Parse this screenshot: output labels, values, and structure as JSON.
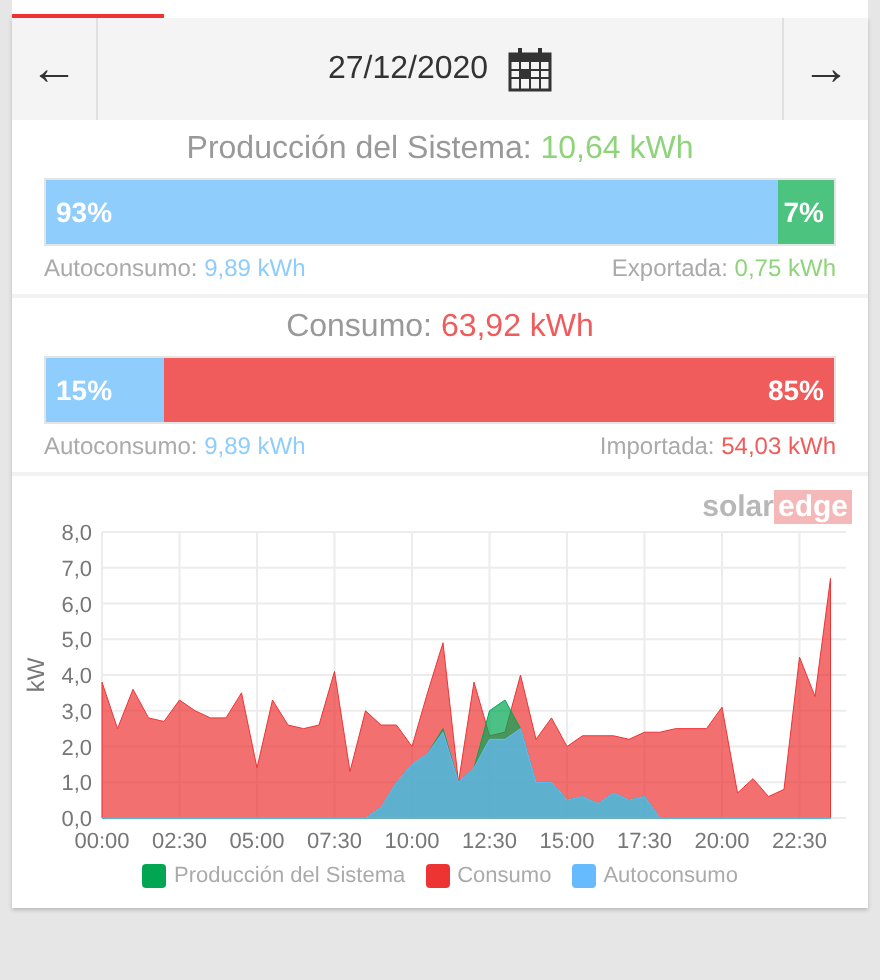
{
  "nav": {
    "prev": "←",
    "date": "27/12/2020",
    "next": "→"
  },
  "production": {
    "label": "Producción del Sistema:",
    "value": "10,64 kWh",
    "bar": [
      {
        "kind": "self",
        "level": 0.93,
        "text": "93%"
      },
      {
        "kind": "export",
        "level": 0.07,
        "text": "7%"
      }
    ],
    "left": {
      "label": "Autoconsumo:",
      "value": "9,89 kWh",
      "kind": "self"
    },
    "right": {
      "label": "Exportada:",
      "value": "0,75 kWh",
      "kind": "export"
    }
  },
  "consumption": {
    "label": "Consumo:",
    "value": "63,92 kWh",
    "bar": [
      {
        "kind": "self",
        "level": 0.15,
        "text": "15%"
      },
      {
        "kind": "import",
        "level": 0.85,
        "text": "85%"
      }
    ],
    "left": {
      "label": "Autoconsumo:",
      "value": "9,89 kWh",
      "kind": "self"
    },
    "right": {
      "label": "Importada:",
      "value": "54,03 kWh",
      "kind": "import"
    }
  },
  "logo": {
    "part1": "solar",
    "part2": "edge"
  },
  "chart": {
    "chart_data": {
      "type": "area",
      "ylabel": "kW",
      "x": [
        0,
        0.5,
        1,
        1.5,
        2,
        2.5,
        3,
        3.5,
        4,
        4.5,
        5,
        5.5,
        6,
        6.5,
        7,
        7.5,
        8,
        8.5,
        9,
        9.5,
        10,
        10.5,
        11,
        11.5,
        12,
        12.5,
        13,
        13.5,
        14,
        14.5,
        15,
        15.5,
        16,
        16.5,
        17,
        17.5,
        18,
        18.5,
        19,
        19.5,
        20,
        20.5,
        21,
        21.5,
        22,
        22.5,
        23,
        23.5
      ],
      "xlim": [
        0,
        24
      ],
      "ylim": [
        0,
        8
      ],
      "grid": true,
      "yticks": [
        {
          "value": 0,
          "label": "0,0"
        },
        {
          "value": 1,
          "label": "1,0"
        },
        {
          "value": 2,
          "label": "2,0"
        },
        {
          "value": 3,
          "label": "3,0"
        },
        {
          "value": 4,
          "label": "4,0"
        },
        {
          "value": 5,
          "label": "5,0"
        },
        {
          "value": 6,
          "label": "6,0"
        },
        {
          "value": 7,
          "label": "7,0"
        },
        {
          "value": 8,
          "label": "8,0"
        }
      ],
      "xticks": [
        {
          "value": 0,
          "label": "00:00"
        },
        {
          "value": 2.5,
          "label": "02:30"
        },
        {
          "value": 5,
          "label": "05:00"
        },
        {
          "value": 7.5,
          "label": "07:30"
        },
        {
          "value": 10,
          "label": "10:00"
        },
        {
          "value": 12.5,
          "label": "12:30"
        },
        {
          "value": 15,
          "label": "15:00"
        },
        {
          "value": 17.5,
          "label": "17:30"
        },
        {
          "value": 20,
          "label": "20:00"
        },
        {
          "value": 22.5,
          "label": "22:30"
        }
      ],
      "series": [
        {
          "name": "Producción del Sistema",
          "color": "#00a651",
          "values": [
            0,
            0,
            0,
            0,
            0,
            0,
            0,
            0,
            0,
            0,
            0,
            0,
            0,
            0,
            0,
            0,
            0,
            0,
            0.3,
            1.0,
            1.5,
            1.8,
            2.5,
            1.0,
            1.4,
            3.0,
            3.3,
            2.5,
            1.0,
            1.0,
            0.5,
            0.6,
            0.4,
            0.7,
            0.5,
            0.6,
            0,
            0,
            0,
            0,
            0,
            0,
            0,
            0,
            0,
            0,
            0,
            0
          ]
        },
        {
          "name": "Consumo",
          "color": "#ee3333",
          "values": [
            3.8,
            2.5,
            3.6,
            2.8,
            2.7,
            3.3,
            3.0,
            2.8,
            2.8,
            3.5,
            1.4,
            3.3,
            2.6,
            2.5,
            2.6,
            4.1,
            1.3,
            3.0,
            2.6,
            2.6,
            2.0,
            3.5,
            4.9,
            1.0,
            3.8,
            2.3,
            2.4,
            4.0,
            2.2,
            2.8,
            2.0,
            2.3,
            2.3,
            2.3,
            2.2,
            2.4,
            2.4,
            2.5,
            2.5,
            2.5,
            3.1,
            0.7,
            1.1,
            0.6,
            0.8,
            4.5,
            3.4,
            6.7
          ]
        },
        {
          "name": "Autoconsumo",
          "color": "#66bbff",
          "values": [
            0,
            0,
            0,
            0,
            0,
            0,
            0,
            0,
            0,
            0,
            0,
            0,
            0,
            0,
            0,
            0,
            0,
            0,
            0.3,
            1.0,
            1.5,
            1.8,
            2.4,
            1.0,
            1.4,
            2.2,
            2.2,
            2.5,
            1.0,
            1.0,
            0.5,
            0.6,
            0.4,
            0.7,
            0.5,
            0.6,
            0,
            0,
            0,
            0,
            0,
            0,
            0,
            0,
            0,
            0,
            0,
            0
          ]
        }
      ]
    }
  }
}
